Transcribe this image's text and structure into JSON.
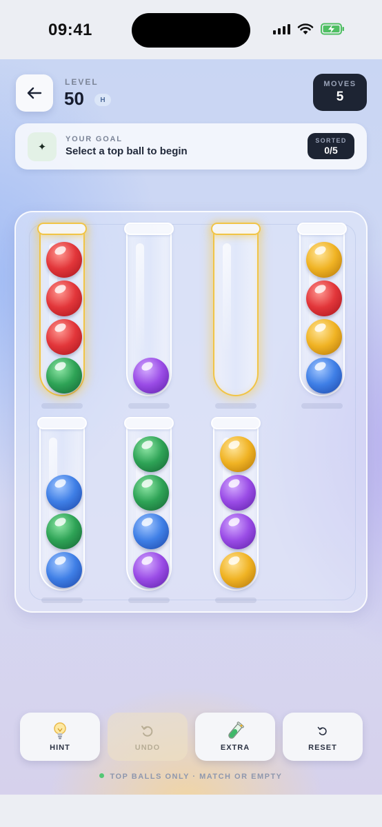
{
  "status": {
    "time": "09:41"
  },
  "header": {
    "level_label": "LEVEL",
    "level_number": "50",
    "difficulty_badge": "H",
    "moves_label": "MOVES",
    "moves_value": "5"
  },
  "goal": {
    "label": "YOUR GOAL",
    "text": "Select a top ball to begin",
    "icon": "sparkle-icon",
    "sorted_label": "SORTED",
    "sorted_value": "0/5"
  },
  "board": {
    "ball_order": "top to bottom",
    "tubes": [
      {
        "balls": [
          "red",
          "red",
          "red",
          "green"
        ],
        "highlighted": true
      },
      {
        "balls": [
          "purple"
        ],
        "highlighted": false
      },
      {
        "balls": [],
        "highlighted": true
      },
      {
        "balls": [
          "yellow",
          "red",
          "yellow",
          "blue"
        ],
        "highlighted": false
      },
      {
        "balls": [
          "blue",
          "green",
          "blue"
        ],
        "highlighted": false
      },
      {
        "balls": [
          "green",
          "green",
          "blue",
          "purple"
        ],
        "highlighted": false
      },
      {
        "balls": [
          "yellow",
          "purple",
          "purple",
          "yellow"
        ],
        "highlighted": false
      }
    ]
  },
  "colors": {
    "red": "#e2363a",
    "green": "#2ea356",
    "yellow": "#f0b324",
    "blue": "#3f7fe6",
    "purple": "#9a4ce6",
    "selection_glow": "#f1c445",
    "dark_panel": "#1d2433"
  },
  "controls": [
    {
      "label": "HINT",
      "icon": "lightbulb-icon",
      "enabled": true
    },
    {
      "label": "UNDO",
      "icon": "undo-icon",
      "enabled": false
    },
    {
      "label": "EXTRA",
      "icon": "test-tube-icon",
      "enabled": true
    },
    {
      "label": "RESET",
      "icon": "reset-icon",
      "enabled": true
    }
  ],
  "footer_hint": "TOP BALLS ONLY · MATCH OR EMPTY"
}
